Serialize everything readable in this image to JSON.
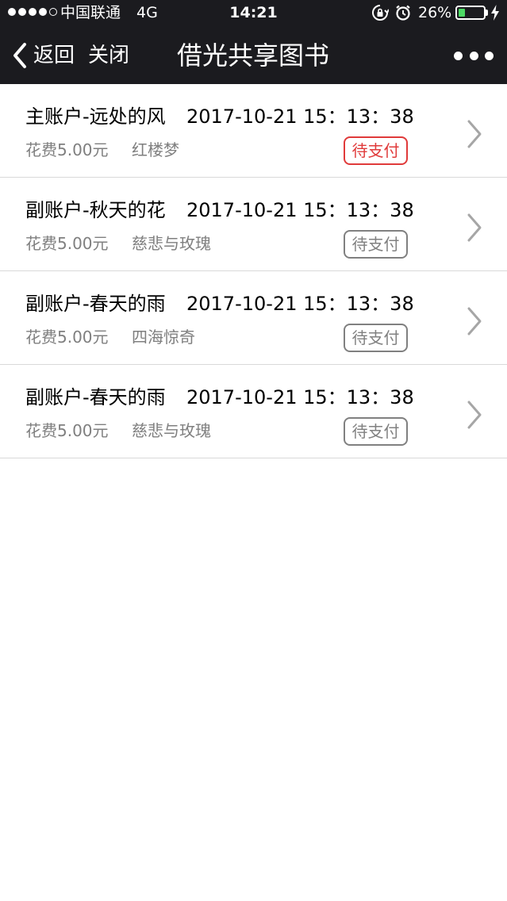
{
  "status_bar": {
    "carrier": "中国联通",
    "network": "4G",
    "time": "14:21",
    "battery_percent": "26%",
    "battery_level": 0.26,
    "signal_bars_filled": 4,
    "signal_bars_total": 5
  },
  "nav": {
    "back_label": "返回",
    "close_label": "关闭",
    "title": "借光共享图书"
  },
  "orders": [
    {
      "account": "主账户-远处的风",
      "datetime": "2017-10-21  15：13：38",
      "cost": "花费5.00元",
      "book": "红楼梦",
      "status": "待支付",
      "status_color": "#e03a3a"
    },
    {
      "account": "副账户-秋天的花",
      "datetime": "2017-10-21  15：13：38",
      "cost": "花费5.00元",
      "book": "慈悲与玫瑰",
      "status": "待支付",
      "status_color": "#808080"
    },
    {
      "account": "副账户-春天的雨",
      "datetime": "2017-10-21  15：13：38",
      "cost": "花费5.00元",
      "book": "四海惊奇",
      "status": "待支付",
      "status_color": "#808080"
    },
    {
      "account": "副账户-春天的雨",
      "datetime": "2017-10-21  15：13：38",
      "cost": "花费5.00元",
      "book": "慈悲与玫瑰",
      "status": "待支付",
      "status_color": "#808080"
    }
  ],
  "colors": {
    "header_bg": "#1b1b1f",
    "battery_fill": "#4cd964",
    "secondary_text": "#7f7f7f",
    "divider": "#d9d9d9"
  },
  "icons": {
    "back": "chevron-left-icon",
    "more": "more-dots-icon",
    "row_arrow": "chevron-right-icon",
    "rotation_lock": "rotation-lock-icon",
    "alarm": "alarm-clock-icon",
    "charging": "charging-bolt-icon"
  }
}
